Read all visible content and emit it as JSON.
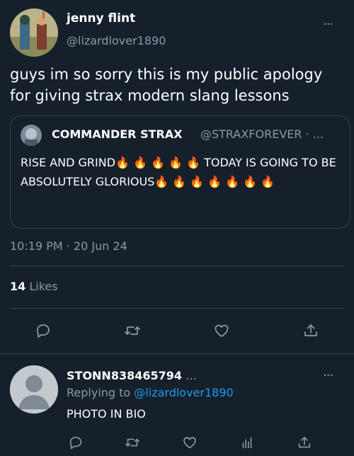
{
  "tweet": {
    "author_name": "jenny flint",
    "author_handle": "@lizardlover1890",
    "text": "guys im so sorry this is my public apology for giving strax modern slang lessons",
    "quote": {
      "author_name": "COMMANDER STRAX",
      "author_handle": "@STRAXFOREVER · ...",
      "text": "RISE AND GRIND🔥 🔥 🔥 🔥 🔥 TODAY IS GOING TO BE ABSOLUTELY GLORIOUS🔥 🔥 🔥 🔥 🔥 🔥 🔥"
    },
    "timestamp": "10:19 PM · 20 Jun 24",
    "likes_count": "14",
    "likes_label": "Likes",
    "more_glyph": "···"
  },
  "actions": [
    {
      "name": "reply",
      "icon": "reply-icon"
    },
    {
      "name": "retweet",
      "icon": "retweet-icon"
    },
    {
      "name": "like",
      "icon": "heart-icon"
    },
    {
      "name": "share",
      "icon": "share-icon"
    }
  ],
  "reply": {
    "author_name": "STONN838465794",
    "author_ellipsis": "...",
    "replying_prefix": "Replying to",
    "replying_handle": "@lizardlover1890",
    "text": "PHOTO IN BIO",
    "more_glyph": "···",
    "actions": [
      {
        "name": "reply",
        "icon": "reply-icon"
      },
      {
        "name": "retweet",
        "icon": "retweet-icon"
      },
      {
        "name": "like",
        "icon": "heart-icon"
      },
      {
        "name": "analytics",
        "icon": "analytics-icon"
      },
      {
        "name": "share",
        "icon": "share-icon"
      }
    ]
  },
  "colors": {
    "background": "#15202b",
    "text": "#ffffff",
    "muted": "#8b98a5",
    "link": "#1d9bf0",
    "border": "#38444d"
  }
}
